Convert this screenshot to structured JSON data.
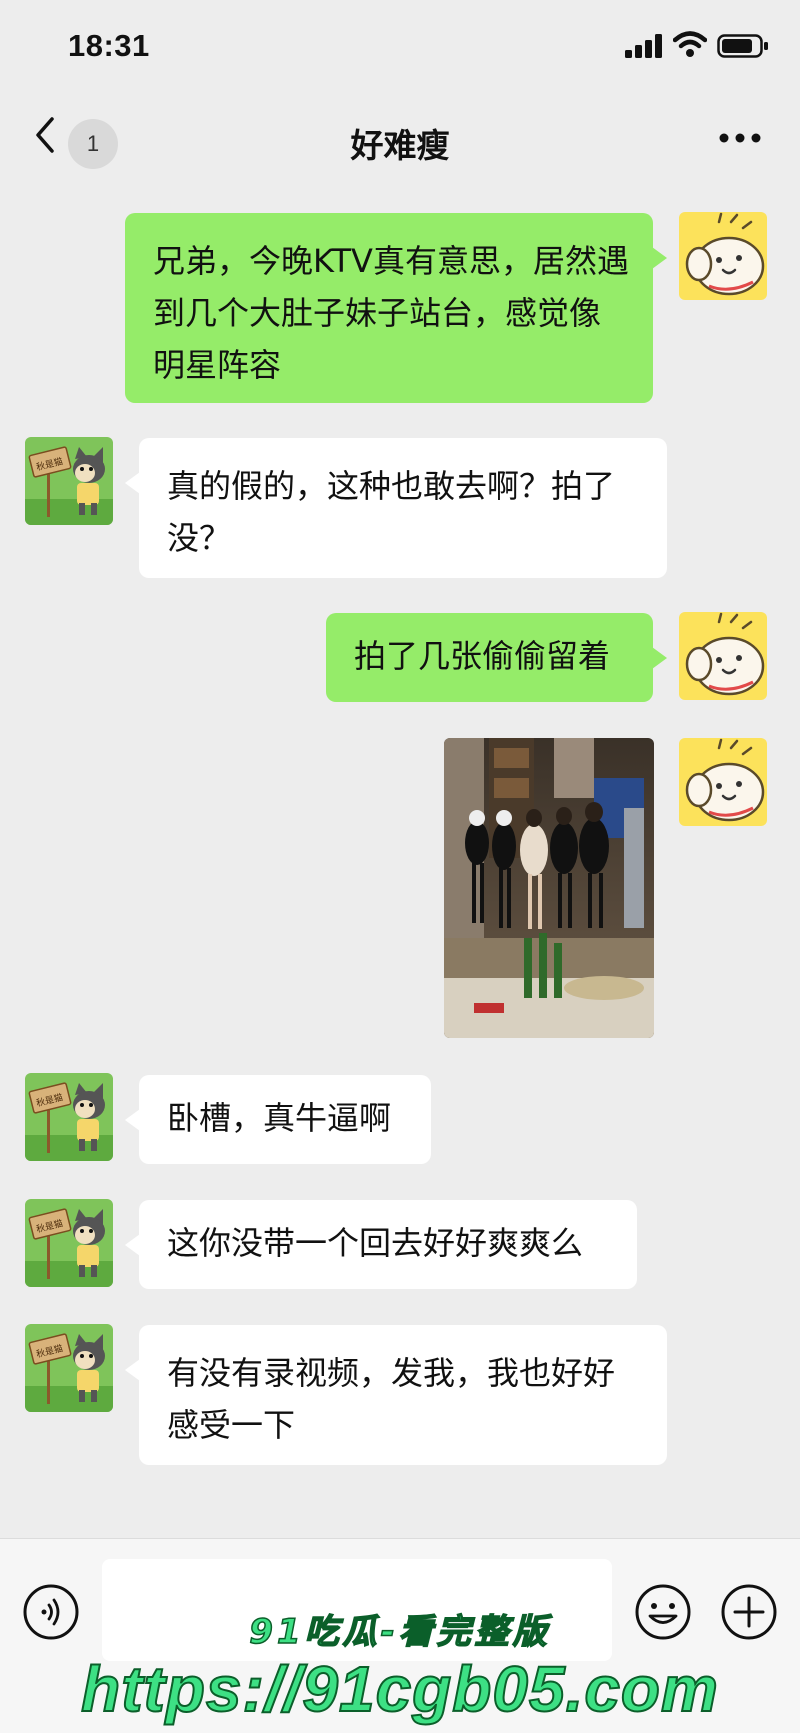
{
  "status_bar": {
    "time": "18:31"
  },
  "nav": {
    "unread_count": "1",
    "title": "好难瘦"
  },
  "messages": [
    {
      "sender": "me",
      "text": "兄弟，今晚KTV真有意思，居然遇到几个大肚子妹子站台，感觉像明星阵容"
    },
    {
      "sender": "friend",
      "text": "真的假的，这种也敢去啊？拍了没？"
    },
    {
      "sender": "me",
      "text": "拍了几张偷偷留着"
    },
    {
      "sender": "me",
      "type": "photo"
    },
    {
      "sender": "friend",
      "text": "卧槽，真牛逼啊"
    },
    {
      "sender": "friend",
      "text": "这你没带一个回去好好爽爽么"
    },
    {
      "sender": "friend",
      "text": "有没有录视频，发我，我也好好感受一下"
    }
  ],
  "friend_avatar": {
    "sign_text": "秋是猫"
  },
  "watermark": {
    "line1": "91吃瓜-看完整版",
    "line2": "https://91cgb05.com"
  },
  "colors": {
    "background": "#ededed",
    "my_bubble": "#95ec69",
    "their_bubble": "#ffffff",
    "watermark": "#3de084"
  },
  "icons": [
    "back-arrow-icon",
    "more-icon",
    "voice-icon",
    "emoji-icon",
    "plus-icon",
    "signal-icon",
    "wifi-icon",
    "battery-icon"
  ]
}
